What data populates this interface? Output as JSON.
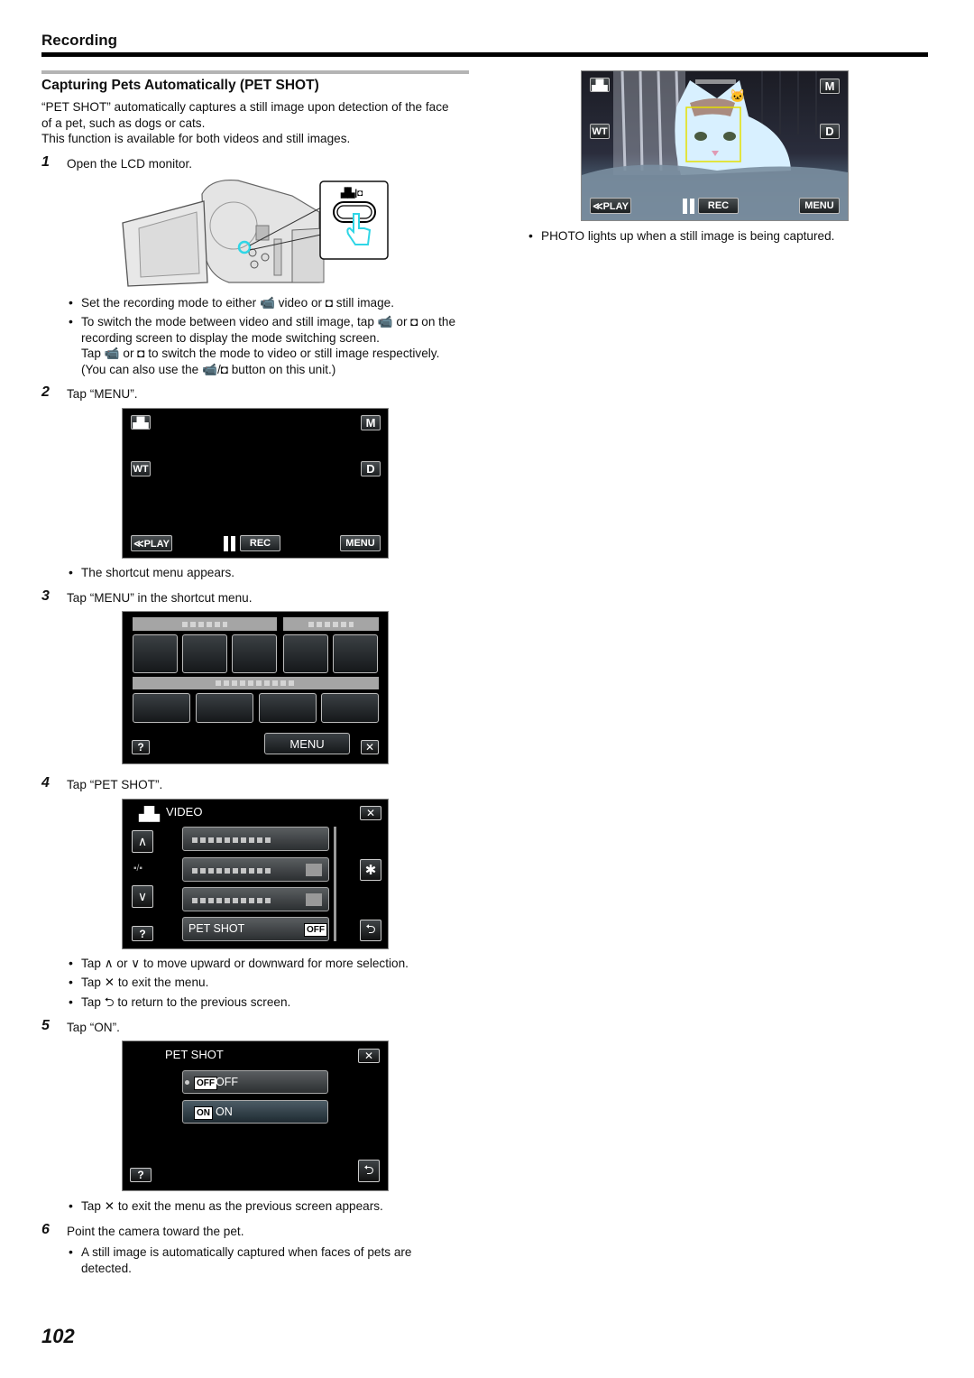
{
  "header": {
    "section": "Recording"
  },
  "title": "Capturing Pets Automatically (PET SHOT)",
  "intro": [
    "“PET SHOT” automatically captures a still image upon detection of the face",
    "of a pet, such as dogs or cats.",
    "This function is available for both videos and still images."
  ],
  "steps": [
    {
      "num": "1",
      "text": "Open the LCD monitor.",
      "bullets": [
        "Set the recording mode to either 📹 video or ◘ still image.",
        [
          "To switch the mode between video and still image, tap 📹 or ◘ on the",
          "recording screen to display the mode switching screen.",
          "Tap 📹 or ◘ to switch the mode to video or still image respectively.",
          "(You can also use the 📹/◘ button on this unit.)"
        ]
      ]
    },
    {
      "num": "2",
      "text": "Tap “MENU”.",
      "bullets": [
        "The shortcut menu appears."
      ]
    },
    {
      "num": "3",
      "text": "Tap “MENU” in the shortcut menu.",
      "bullets": []
    },
    {
      "num": "4",
      "text": "Tap “PET SHOT”.",
      "bullets": [
        "Tap ∧ or ∨ to move upward or downward for more selection.",
        "Tap ✕ to exit the menu.",
        "Tap ⮌ to return to the previous screen."
      ]
    },
    {
      "num": "5",
      "text": "Tap “ON”.",
      "bullets": [
        "Tap ✕ to exit the menu as the previous screen appears."
      ]
    },
    {
      "num": "6",
      "text": "Point the camera toward the pet.",
      "bullets": [
        [
          "A still image is automatically captured when faces of pets are",
          "detected."
        ]
      ]
    }
  ],
  "screen_rec": {
    "mode_icon": "video-camera-icon",
    "m": "M",
    "wt": "WT",
    "d": "D",
    "play": "≪PLAY",
    "rec": "REC",
    "menu": "MENU"
  },
  "screen_shortcut": {
    "menu": "MENU",
    "help": "?",
    "close": "✕"
  },
  "screen_video_menu": {
    "title": "VIDEO",
    "page": "▪/▪",
    "item_pet_shot": "PET SHOT",
    "pet_shot_value": "OFF",
    "help": "?"
  },
  "screen_pet_shot": {
    "title": "PET SHOT",
    "off_badge": "OFF",
    "off_label": "OFF",
    "on_badge": "ON",
    "on_label": "ON",
    "help": "?"
  },
  "right_note": "PHOTO lights up when a still image is being captured.",
  "page_number": "102",
  "colors": {
    "face_frame": "#e6e000",
    "hand_cyan": "#2fd6e6"
  }
}
